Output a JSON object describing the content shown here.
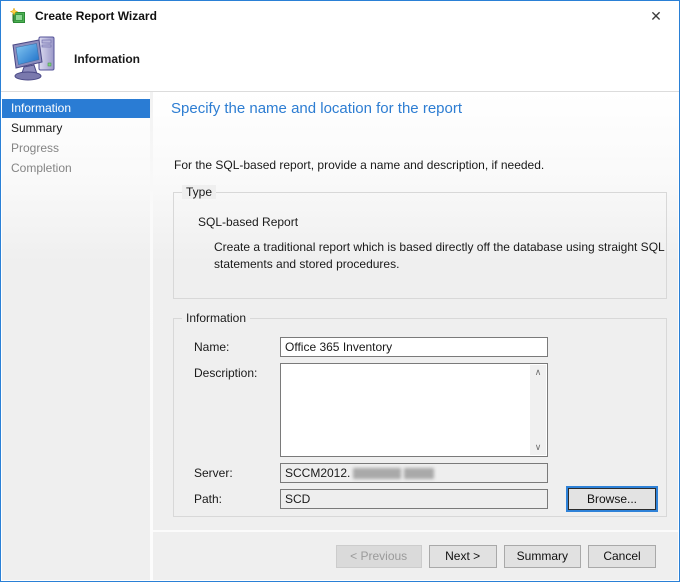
{
  "window": {
    "title": "Create Report Wizard"
  },
  "icons": {
    "close": "✕",
    "scroll_up": "∧",
    "scroll_down": "∨"
  },
  "header": {
    "step_title": "Information"
  },
  "sidebar": {
    "items": [
      {
        "label": "Information",
        "state": "selected"
      },
      {
        "label": "Summary",
        "state": "enabled"
      },
      {
        "label": "Progress",
        "state": "disabled"
      },
      {
        "label": "Completion",
        "state": "disabled"
      }
    ]
  },
  "content": {
    "heading": "Specify the name and location for the report",
    "intro": "For the SQL-based report, provide a name and description, if needed.",
    "type_group": {
      "label": "Type",
      "report_type": "SQL-based Report",
      "report_type_description": "Create a traditional report which is based directly off the database using straight SQL statements and stored procedures."
    },
    "info_group": {
      "label": "Information",
      "name_label": "Name:",
      "name_value": "Office 365 Inventory",
      "description_label": "Description:",
      "description_value": "",
      "server_label": "Server:",
      "server_value": "SCCM2012.",
      "server_redacted": true,
      "path_label": "Path:",
      "path_value": "SCD",
      "browse_button": "Browse..."
    }
  },
  "footer": {
    "buttons": [
      {
        "label": "< Previous",
        "state": "disabled"
      },
      {
        "label": "Next >",
        "state": "enabled"
      },
      {
        "label": "Summary",
        "state": "enabled"
      },
      {
        "label": "Cancel",
        "state": "enabled"
      }
    ]
  },
  "colors": {
    "accent_blue": "#2a7cd4",
    "heading_blue": "#2d7dd2",
    "window_border": "#2a80d6",
    "panel_gray": "#efefef",
    "focus_ring": "#2f82d8"
  }
}
